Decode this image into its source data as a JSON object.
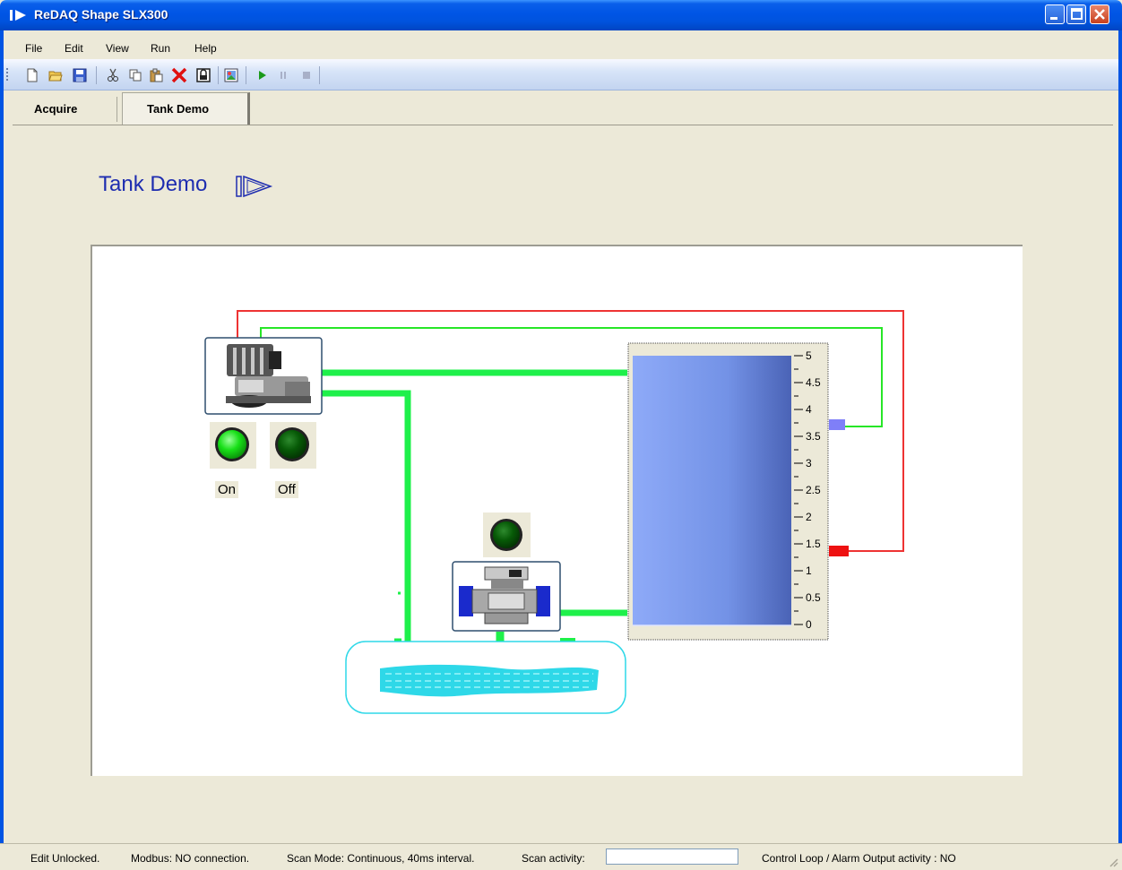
{
  "window": {
    "title": "ReDAQ Shape SLX300"
  },
  "menu": [
    "File",
    "Edit",
    "View",
    "Run",
    "Help"
  ],
  "toolbar": {
    "icons": [
      "new-file-icon",
      "open-folder-icon",
      "save-icon",
      "cut-icon",
      "copy-icon",
      "paste-icon",
      "delete-icon",
      "lock-icon",
      "image-icon",
      "run-icon",
      "pause-icon",
      "stop-icon"
    ]
  },
  "tabs": [
    {
      "label": "Acquire",
      "selected": false
    },
    {
      "label": "Tank Demo",
      "selected": true
    }
  ],
  "page": {
    "title": "Tank Demo"
  },
  "indicators": {
    "on_label": "On",
    "off_label": "Off",
    "on_color": "#18E018",
    "off_color": "#075A07"
  },
  "tank": {
    "level": 5,
    "scale": [
      "5",
      "4.5",
      "4",
      "3.5",
      "3",
      "2.5",
      "2",
      "1.5",
      "1",
      "0.5",
      "0"
    ],
    "fill_color": "#7C9CF0",
    "high_alarm_color": "#7F7FF8",
    "low_alarm_color": "#EE1111"
  },
  "colors": {
    "pipe": "#1EF04A",
    "wire_red": "#EE3333",
    "wire_green": "#27E627",
    "reservoir": "#2ED8E8"
  },
  "status": {
    "edit": "Edit Unlocked.",
    "modbus": "Modbus: NO connection.",
    "scan_mode": "Scan Mode: Continuous, 40ms interval.",
    "scan_activity": "Scan activity:",
    "control_loop": "Control Loop / Alarm Output activity :  NO"
  }
}
